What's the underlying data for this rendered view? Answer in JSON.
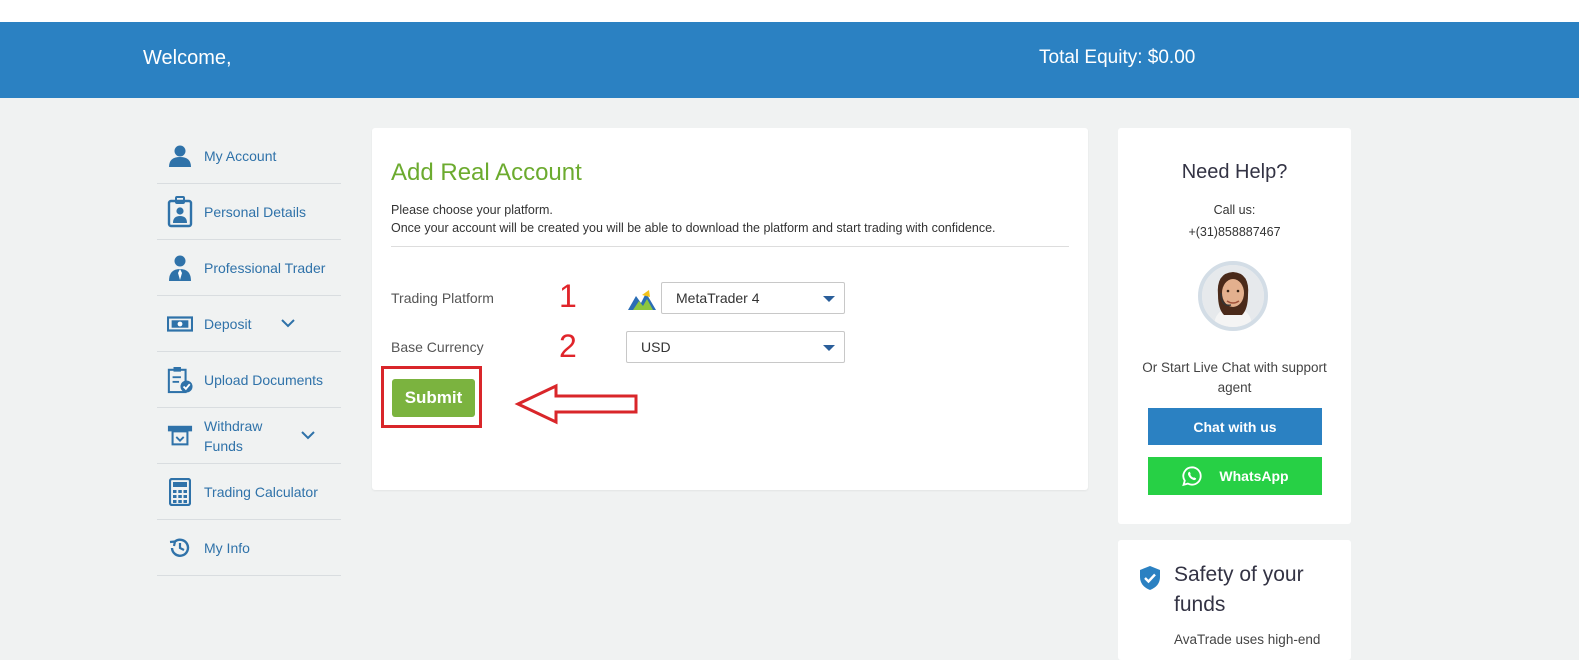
{
  "header": {
    "welcome": "Welcome,",
    "equity": "Total Equity: $0.00"
  },
  "sidebar": {
    "items": [
      {
        "label": "My Account",
        "icon": "user-icon"
      },
      {
        "label": "Personal Details",
        "icon": "id-badge-icon"
      },
      {
        "label": "Professional Trader",
        "icon": "professional-user-icon"
      },
      {
        "label": "Deposit",
        "icon": "banknote-icon",
        "expandable": true
      },
      {
        "label": "Upload Documents",
        "icon": "document-check-icon"
      },
      {
        "label": "Withdraw Funds",
        "icon": "withdraw-icon",
        "expandable": true
      },
      {
        "label": "Trading Calculator",
        "icon": "calculator-icon"
      },
      {
        "label": "My Info",
        "icon": "history-icon"
      }
    ]
  },
  "form": {
    "title": "Add Real Account",
    "desc_line1": "Please choose your platform.",
    "desc_line2": "Once your account will be created you will be able to download the platform and start trading with confidence.",
    "platform_label": "Trading Platform",
    "platform_value": "MetaTrader 4",
    "currency_label": "Base Currency",
    "currency_value": "USD",
    "submit_label": "Submit"
  },
  "annotations": {
    "step1": "1",
    "step2": "2",
    "color": "#e0242a"
  },
  "help": {
    "title": "Need Help?",
    "call_label": "Call us:",
    "phone": "+(31)858887467",
    "chat_text": "Or Start Live Chat with support agent",
    "chat_button": "Chat with us",
    "whatsapp_button": "WhatsApp"
  },
  "safety": {
    "title": "Safety of your funds",
    "desc": "AvaTrade uses high-end"
  },
  "colors": {
    "brand_blue": "#2b81c2",
    "accent_green": "#6cab2f",
    "submit_green": "#7bb33f",
    "whatsapp_green": "#27d045"
  }
}
